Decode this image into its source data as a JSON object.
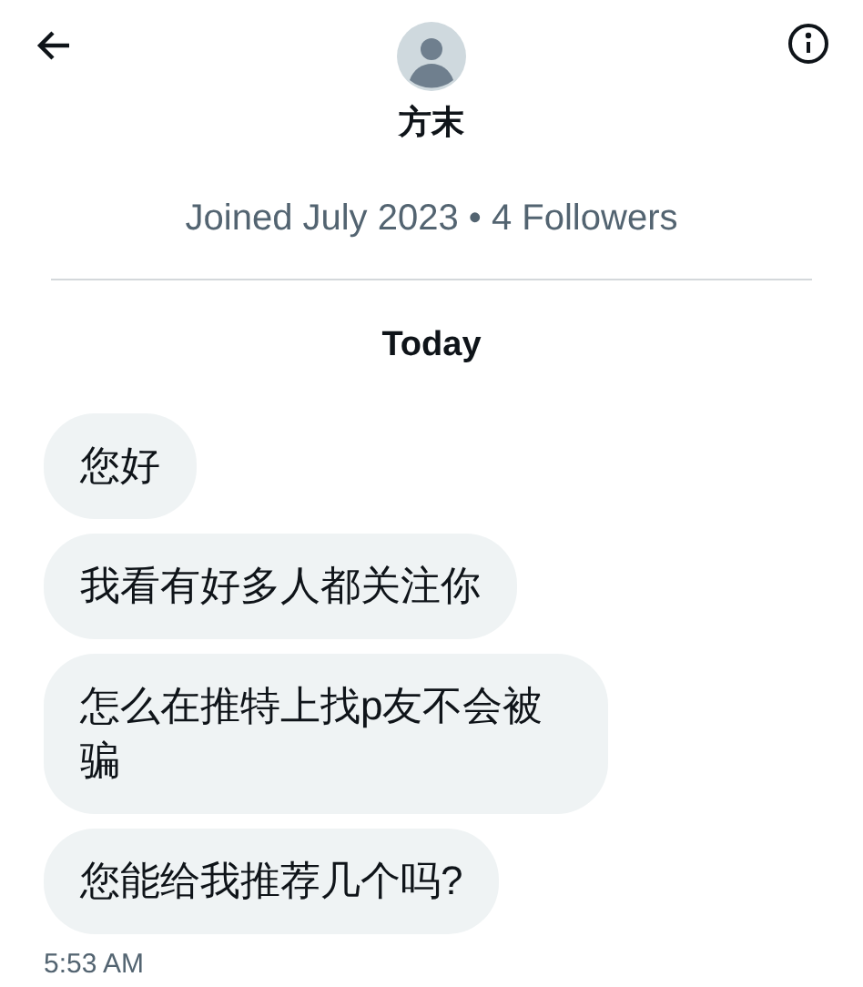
{
  "header": {
    "name": "方末",
    "subtitle": "Joined July 2023 • 4 Followers"
  },
  "day_label": "Today",
  "messages": [
    {
      "text": "您好"
    },
    {
      "text": "我看有好多人都关注你"
    },
    {
      "text": "怎么在推特上找p友不会被骗"
    },
    {
      "text": "您能给我推荐几个吗?"
    }
  ],
  "timestamp": "5:53 AM"
}
